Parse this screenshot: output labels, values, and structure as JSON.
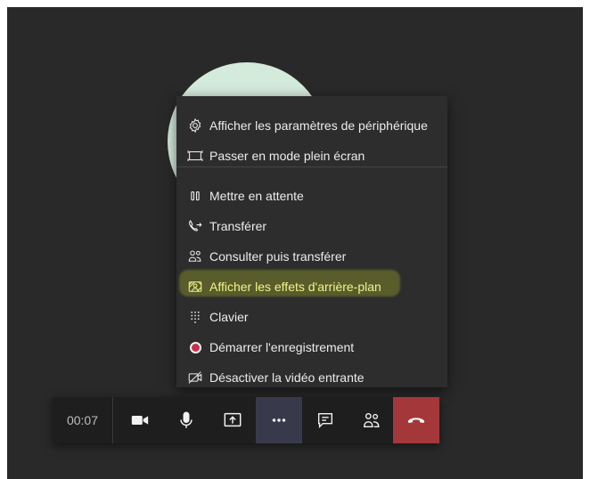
{
  "call": {
    "timer": "00:07"
  },
  "menu": {
    "items": [
      {
        "label": "Afficher les paramètres de périphérique",
        "icon": "gear-icon"
      },
      {
        "label": "Passer en mode plein écran",
        "icon": "fullscreen-icon"
      },
      {
        "label": "Mettre en attente",
        "icon": "pause-icon"
      },
      {
        "label": "Transférer",
        "icon": "transfer-call-icon"
      },
      {
        "label": "Consulter puis transférer",
        "icon": "consult-transfer-icon"
      },
      {
        "label": "Afficher les effets d'arrière-plan",
        "icon": "background-effects-icon",
        "highlighted": true
      },
      {
        "label": "Clavier",
        "icon": "dialpad-icon"
      },
      {
        "label": "Démarrer l'enregistrement",
        "icon": "record-icon"
      },
      {
        "label": "Désactiver la vidéo entrante",
        "icon": "video-off-icon"
      }
    ]
  },
  "toolbar": {
    "buttons": [
      "camera-icon",
      "microphone-icon",
      "share-screen-icon",
      "more-options-icon",
      "chat-icon",
      "participants-icon",
      "hang-up-icon"
    ]
  },
  "colors": {
    "stage_background": "#292929",
    "menu_background": "#2d2d2d",
    "toolbar_background": "#1e1e1e",
    "highlight_text": "#f0f58a",
    "hangup_red": "#a4373a",
    "avatar": "#d4eadb"
  }
}
